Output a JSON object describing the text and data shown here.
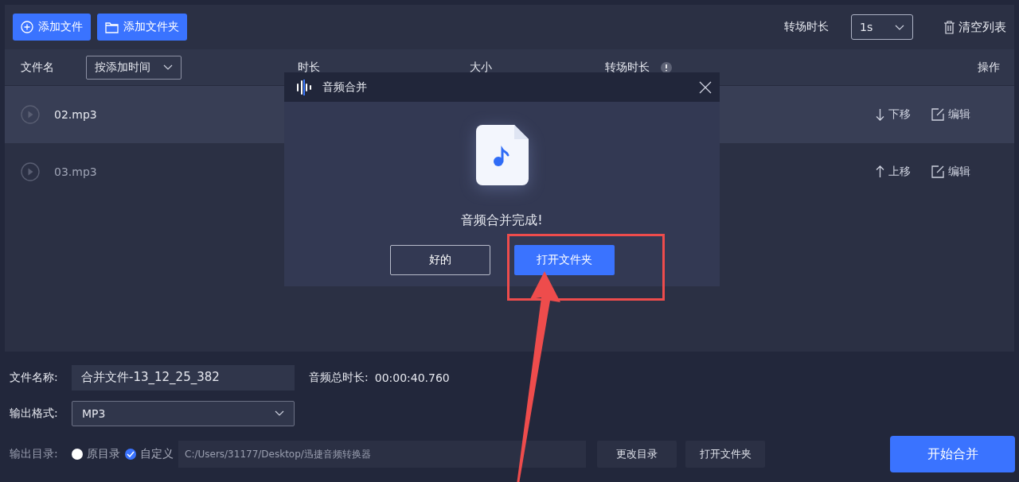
{
  "toolbar": {
    "add_file": "添加文件",
    "add_folder": "添加文件夹",
    "transition_label": "转场时长",
    "transition_value": "1s",
    "clear_list": "清空列表"
  },
  "table": {
    "columns": {
      "name": "文件名",
      "sort": "按添加时间",
      "duration": "时长",
      "size": "大小",
      "transition": "转场时长",
      "actions": "操作"
    },
    "rows": [
      {
        "name": "02.mp3",
        "selected": true,
        "move": {
          "kind": "down",
          "label": "下移"
        },
        "edit": "编辑"
      },
      {
        "name": "03.mp3",
        "selected": false,
        "move": {
          "kind": "up",
          "label": "上移"
        },
        "edit": "编辑"
      }
    ]
  },
  "dialog": {
    "title": "音频合并",
    "message": "音频合并完成!",
    "buttons": [
      {
        "label": "好的",
        "kind": "outline"
      },
      {
        "label": "打开文件夹",
        "kind": "primary"
      }
    ]
  },
  "bottom": {
    "filename_label": "文件名称:",
    "filename_value": "合并文件-13_12_25_382",
    "total_label": "音频总时长:",
    "total_value": "00:00:40.760",
    "format_label": "输出格式:",
    "format_value": "MP3",
    "output_label": "输出目录:",
    "output_options": [
      {
        "label": "原目录",
        "selected": false
      },
      {
        "label": "自定义",
        "selected": true
      }
    ],
    "path": "C:/Users/31177/Desktop/迅捷音频转换器",
    "change_dir": "更改目录",
    "open_folder": "打开文件夹",
    "start": "开始合并"
  }
}
